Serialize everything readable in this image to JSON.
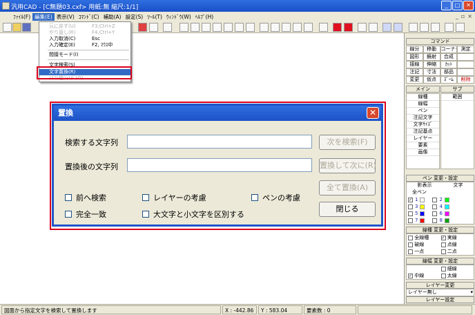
{
  "window": {
    "title": "汎用CAD - [C無題03.cxf>  用紙:無  縮尺:1/1]"
  },
  "menubar": [
    "ﾌｧｲﾙ(F)",
    "編集(E)",
    "表示(V)",
    "ｺﾏﾝﾄﾞ(C)",
    "補助(A)",
    "設定(S)",
    "ﾂｰﾙ(T)",
    "ｳｨﾝﾄﾞｳ(W)",
    "ﾍﾙﾌﾟ(H)"
  ],
  "edit_menu": {
    "undo": {
      "label": "元に戻す(U)",
      "key": "F3,Ctrl+Z"
    },
    "redo": {
      "label": "やり直し(R)",
      "key": "F4,Ctrl+Y"
    },
    "cancel_input": {
      "label": "入力取消(C)",
      "key": "Esc"
    },
    "confirm_input": {
      "label": "入力確定(E)",
      "key": "F2, ﾏｳｽ中"
    },
    "interval_mode": {
      "label": "間接モード(I)"
    },
    "text_search": {
      "label": "文字検索(S)"
    },
    "text_replace": {
      "label": "文字置換(R)"
    },
    "text_other": {
      "label": "ﾃｷｽﾄ値ﾌｫﾙﾀﾞ(O)"
    }
  },
  "command_panel": {
    "title": "コマンド",
    "cells": [
      "線分",
      "移動",
      "コーナー",
      "測定",
      "図形",
      "鏡射",
      "合成",
      "",
      "接線",
      "伸縮",
      "ｶｯﾄ",
      "",
      "注記",
      "寸法",
      "部品",
      "",
      "変更",
      "仮点",
      "ｽﾞｰﾑ",
      "削除"
    ],
    "main_label": "メイン",
    "sub_label": "サブ",
    "main_items": [
      "線種",
      "線幅",
      "ペン",
      "注記文字",
      "文字ｻｲｽﾞ",
      "注記基点",
      "レイヤー",
      "要素",
      "画像"
    ],
    "sub_items": [
      "範囲"
    ]
  },
  "pen_panel": {
    "title": "ペン 変更・設定",
    "col_headers": [
      "影表示",
      "文字"
    ],
    "all_pens": "全ペン",
    "rows": [
      {
        "a": "1",
        "b": "2",
        "checked": true,
        "c1": "#ffffff",
        "c2": "#00ff00"
      },
      {
        "a": "3",
        "b": "4",
        "checked": false,
        "c1": "#ffff00",
        "c2": "#00ffff"
      },
      {
        "a": "5",
        "b": "6",
        "checked": false,
        "c1": "#0000ff",
        "c2": "#ff00ff"
      },
      {
        "a": "7",
        "b": "8",
        "checked": false,
        "c1": "#ff0000",
        "c2": "#00a000"
      }
    ]
  },
  "linetype_panel": {
    "title": "線種 変更・設定",
    "items": [
      "全線種",
      "実線",
      "破線",
      "点線",
      "一点",
      "二点"
    ]
  },
  "linewidth_panel": {
    "title": "線幅 変更・設定",
    "items": [
      "",
      "細線",
      "中線",
      "太線"
    ]
  },
  "layer_panel": {
    "title": "レイヤー変更",
    "value": "レイヤー無し",
    "setting": "レイヤー設定"
  },
  "dialog": {
    "title": "置換",
    "search_label": "検索する文字列",
    "search_value": "",
    "replace_label": "置換後の文字列",
    "replace_value": "",
    "find_next": "次を検索(F)",
    "replace_next": "置換して次に(R)",
    "replace_all": "全て置換(A)",
    "close": "閉じる",
    "options": [
      "前へ検索",
      "レイヤーの考慮",
      "ペンの考慮",
      "完全一致",
      "大文字と小文字を区別する"
    ]
  },
  "status": {
    "message": "図面から指定文字を検索して置換します",
    "x": "X : -442.86",
    "y": "Y : 583.04",
    "count": "要素数 : 0"
  }
}
